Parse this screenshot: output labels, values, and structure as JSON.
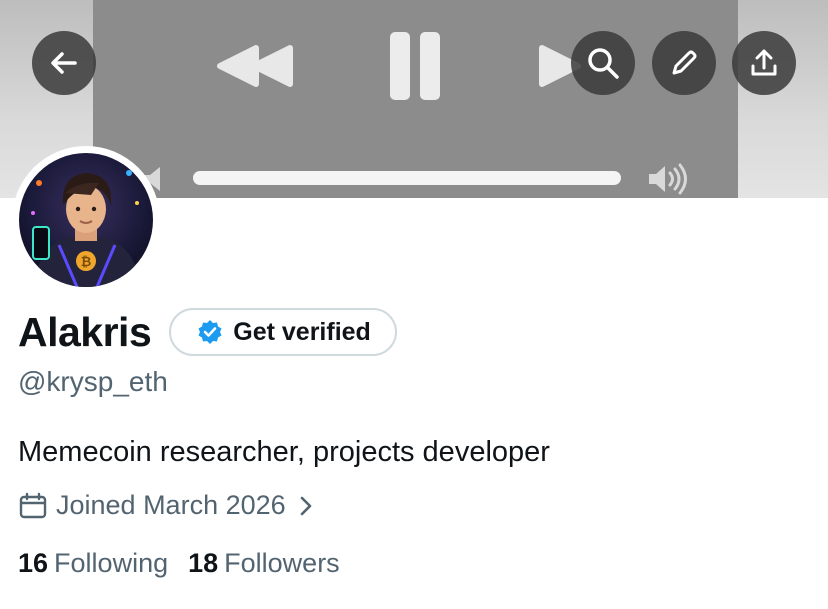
{
  "header": {
    "back_icon": "arrow-left-icon",
    "actions": [
      {
        "name": "search-button",
        "icon": "search-icon"
      },
      {
        "name": "edit-button",
        "icon": "pencil-icon"
      },
      {
        "name": "share-button",
        "icon": "share-icon"
      }
    ]
  },
  "media_player": {
    "state": "playing",
    "progress": 1.0,
    "controls": [
      "rewind-icon",
      "pause-icon",
      "fast-forward-icon",
      "volume-icon"
    ]
  },
  "profile": {
    "name": "Alakris",
    "verify_label": "Get verified",
    "handle": "@krysp_eth",
    "bio": "Memecoin researcher, projects developer",
    "joined": "Joined March 2026",
    "following_count": "16",
    "following_label": "Following",
    "followers_count": "18",
    "followers_label": "Followers"
  },
  "colors": {
    "verified_badge": "#1d9bf0",
    "text_primary": "#0f1419",
    "text_secondary": "#536471"
  }
}
